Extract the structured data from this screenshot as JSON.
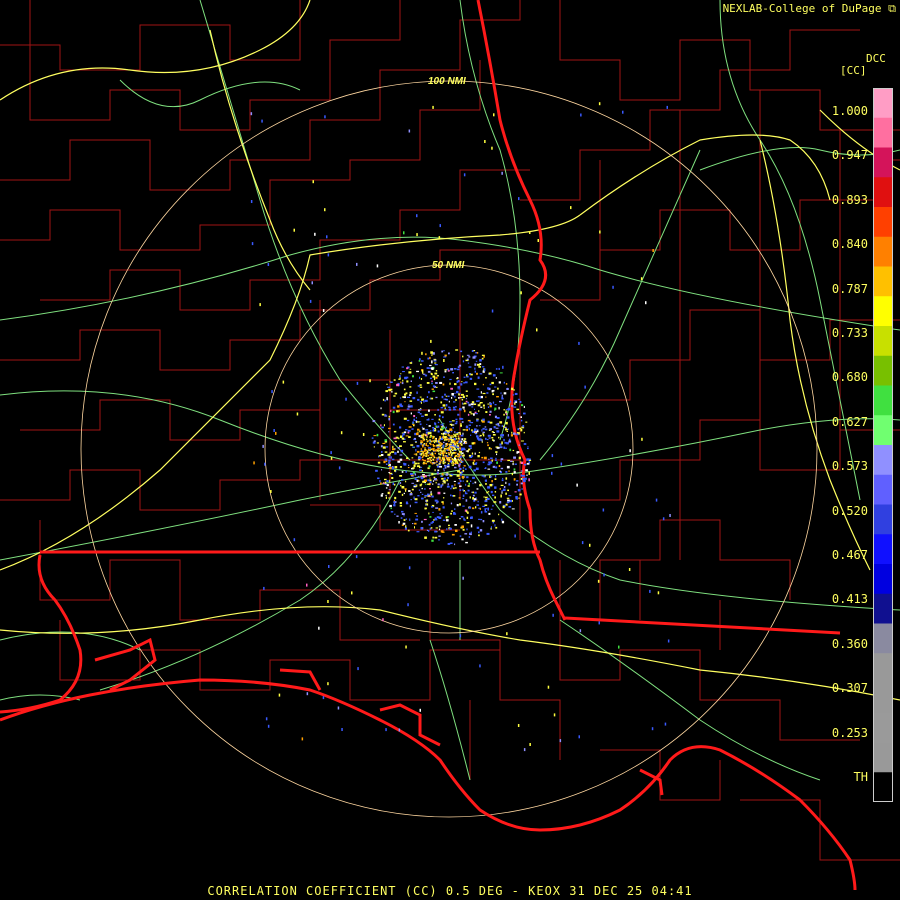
{
  "credit": "NEXLAB-College of DuPage",
  "credit_icon": "external-link-icon",
  "footer": "CORRELATION COEFFICIENT (CC) 0.5 DEG - KEOX 31 DEC 25 04:41",
  "legend": {
    "title": "DCC",
    "units": "[CC]",
    "labels": [
      "1.000",
      "0.947",
      "0.893",
      "0.840",
      "0.787",
      "0.733",
      "0.680",
      "0.627",
      "0.573",
      "0.520",
      "0.467",
      "0.413",
      "0.360",
      "0.307",
      "0.253",
      "TH"
    ],
    "colors": [
      "#ff9dc5",
      "#ff6fa0",
      "#d4145a",
      "#e01010",
      "#ff4000",
      "#ff8000",
      "#ffc000",
      "#ffff00",
      "#c8e000",
      "#78c000",
      "#40e040",
      "#70ff70",
      "#9090ff",
      "#6060ff",
      "#3040e0",
      "#1010ff",
      "#0000e0",
      "#101090",
      "#8a8aa0",
      "#999999",
      "#999999",
      "#9a9a9a",
      "#999999",
      "#000000"
    ]
  },
  "map": {
    "range_rings": [
      {
        "label": "100 NMI",
        "radius_nmi": 100
      },
      {
        "label": "50 NMI",
        "radius_nmi": 50
      }
    ],
    "colors": {
      "county": "#a01414",
      "state": "#ff1a1a",
      "highway": "#ffff60",
      "road": "#7fe07f",
      "ring": "#ffd7a0",
      "echo_blue": "#3a5aff",
      "echo_yellow": "#ffff40"
    }
  }
}
